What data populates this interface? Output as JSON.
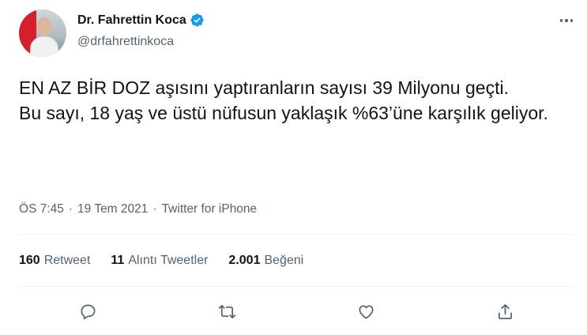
{
  "author": {
    "display_name": "Dr. Fahrettin Koca",
    "handle": "@drfahrettinkoca"
  },
  "tweet": {
    "text": "EN AZ BİR DOZ aşısını yaptıranların sayısı 39 Milyonu geçti.\nBu sayı, 18 yaş ve üstü nüfusun yaklaşık %63’üne karşılık geliyor.",
    "time": "ÖS 7:45",
    "separator": "·",
    "date": "19 Tem 2021",
    "source": "Twitter for iPhone"
  },
  "stats": {
    "retweets": {
      "count": "160",
      "label": "Retweet"
    },
    "quotes": {
      "count": "11",
      "label": "Alıntı Tweetler"
    },
    "likes": {
      "count": "2.001",
      "label": "Beğeni"
    }
  },
  "icons": {
    "verified": "verified-badge-icon",
    "more": "more-options-icon",
    "reply": "reply-icon",
    "retweet": "retweet-icon",
    "like": "heart-icon",
    "share": "share-icon"
  },
  "colors": {
    "verified": "#1d9bf0",
    "text": "#0f1419",
    "secondary": "#536471",
    "border": "#eff3f4"
  }
}
